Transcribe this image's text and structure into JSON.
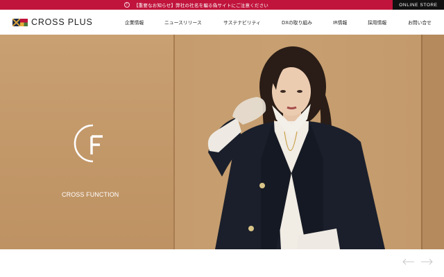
{
  "notice": {
    "icon": "info-icon",
    "text": "【重要なお知らせ】弊社の社名を騙る偽サイトにご注意ください"
  },
  "online_store": {
    "label": "ONLINE STORE"
  },
  "header": {
    "logo_text": "CROSS PLUS",
    "nav": [
      {
        "label": "企業情報"
      },
      {
        "label": "ニュースリリース"
      },
      {
        "label": "サステナビリティ"
      },
      {
        "label": "DXの取り組み"
      },
      {
        "label": "IR情報"
      },
      {
        "label": "採用情報"
      },
      {
        "label": "お問い合せ"
      }
    ]
  },
  "hero": {
    "brand_name": "CROSS FUNCTION",
    "brand_mark": "cf-logo"
  },
  "slider": {
    "prev_icon": "arrow-left-icon",
    "next_icon": "arrow-right-icon"
  },
  "colors": {
    "notice_bg": "#c0143c",
    "store_bg": "#111111",
    "hero_bg": "#c49a6c"
  }
}
